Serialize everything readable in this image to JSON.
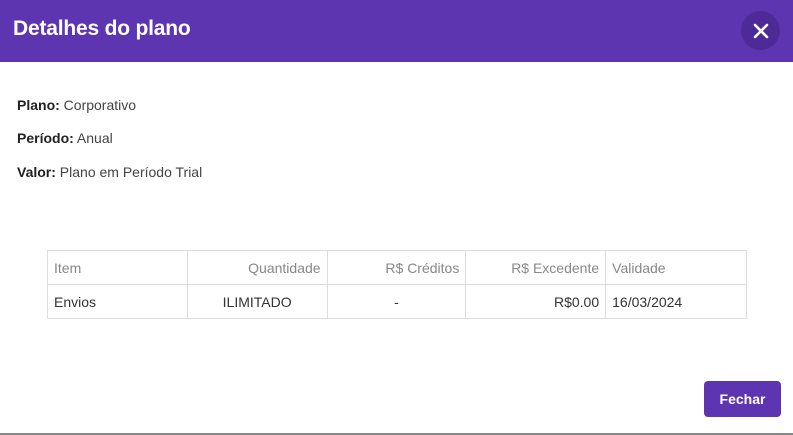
{
  "header": {
    "title": "Detalhes do plano",
    "close_icon": "close-icon",
    "background": "#5e35b1"
  },
  "info": {
    "plano_label": "Plano:",
    "plano_value": "Corporativo",
    "periodo_label": "Período:",
    "periodo_value": "Anual",
    "valor_label": "Valor:",
    "valor_value": "Plano em Período Trial"
  },
  "table": {
    "columns": [
      "Item",
      "Quantidade",
      "R$ Créditos",
      "R$ Excedente",
      "Validade"
    ],
    "rows": [
      [
        "Envios",
        "ILIMITADO",
        "-",
        "R$0.00",
        "16/03/2024"
      ]
    ]
  },
  "footer": {
    "close_label": "Fechar",
    "button_color": "#5e35b1"
  }
}
